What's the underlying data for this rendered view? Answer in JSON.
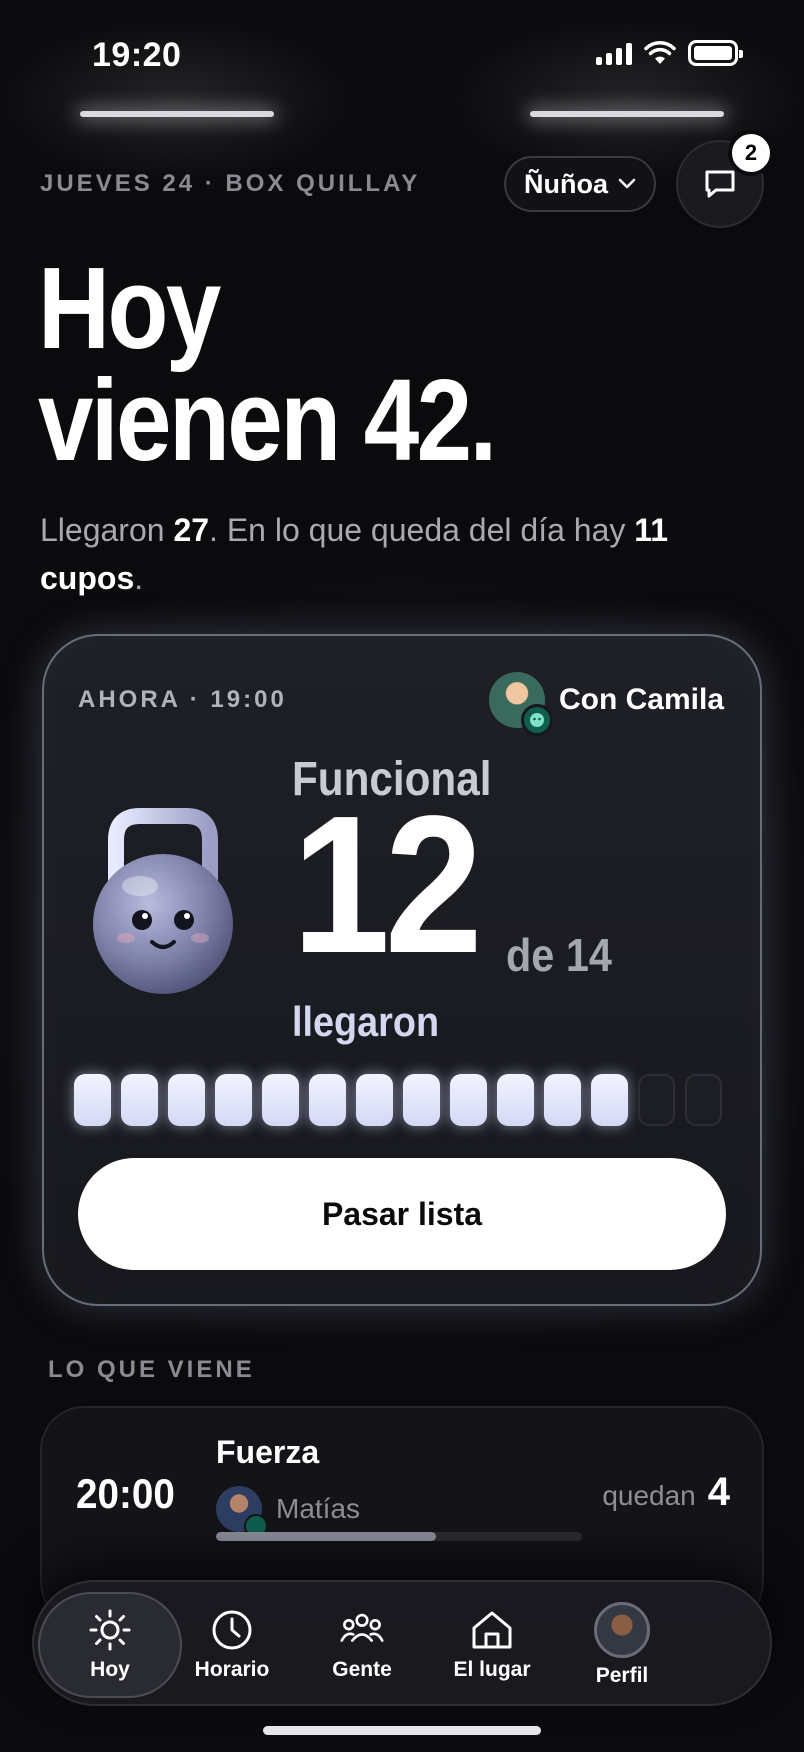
{
  "status_bar": {
    "time": "19:20"
  },
  "header": {
    "date_line": "JUEVES 24 · BOX QUILLAY",
    "location": "Ñuñoa",
    "messages_badge": "2"
  },
  "headline": {
    "line1": "Hoy",
    "line2": "vienen 42."
  },
  "subline": {
    "part1": "Llegaron ",
    "arrived": "27",
    "part2": ". En lo que queda del día hay ",
    "slots": "11 cupos",
    "part3": "."
  },
  "current_class": {
    "time_label": "AHORA · 19:00",
    "coach": "Con Camila",
    "name": "Funcional",
    "arrived_count": "12",
    "capacity_label": "de 14",
    "arrived_label": "llegaron",
    "arrived_value": 12,
    "capacity_value": 14,
    "button_label": "Pasar lista"
  },
  "upcoming": {
    "section_label": "LO QUE VIENE",
    "items": [
      {
        "time": "20:00",
        "name": "Fuerza",
        "coach": "Matías",
        "remaining_label": "quedan",
        "remaining": "4",
        "fill_fraction": 0.6
      }
    ]
  },
  "tabbar": {
    "tabs": [
      {
        "label": "Hoy",
        "icon": "sun-icon",
        "active": true
      },
      {
        "label": "Horario",
        "icon": "clock-icon",
        "active": false
      },
      {
        "label": "Gente",
        "icon": "people-icon",
        "active": false
      },
      {
        "label": "El lugar",
        "icon": "house-icon",
        "active": false
      },
      {
        "label": "Perfil",
        "icon": "avatar",
        "active": false
      }
    ]
  },
  "colors": {
    "background": "#0b0b0e",
    "segment_on": "#e4e8ff",
    "segment_off": "#1d1e23",
    "muted_text": "#8a8a92"
  }
}
